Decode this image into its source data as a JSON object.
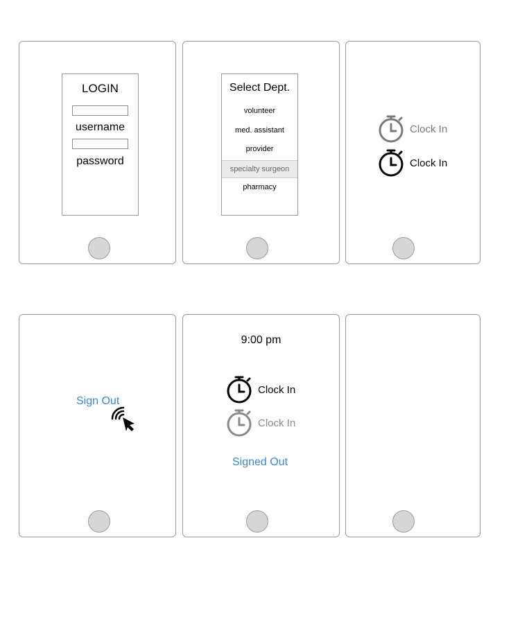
{
  "screens": {
    "login": {
      "title": "LOGIN",
      "username_label": "username",
      "password_label": "password"
    },
    "dept": {
      "title": "Select Dept.",
      "items": [
        {
          "label": "volunteer",
          "selected": false
        },
        {
          "label": "med. assistant",
          "selected": false
        },
        {
          "label": "provider",
          "selected": false
        },
        {
          "label": "specialty surgeon",
          "selected": true
        },
        {
          "label": "pharmacy",
          "selected": false
        }
      ]
    },
    "clock_in": {
      "options": [
        {
          "label": "Clock In",
          "state": "inactive"
        },
        {
          "label": "Clock In",
          "state": "active"
        }
      ]
    },
    "sign_out": {
      "link_label": "Sign Out"
    },
    "status": {
      "time": "9:00 pm",
      "options": [
        {
          "label": "Clock In",
          "state": "active"
        },
        {
          "label": "Clock In",
          "state": "inactive"
        }
      ],
      "signed_out_label": "Signed Out"
    }
  },
  "colors": {
    "link": "#3d86d0",
    "inactive": "#7a7a7a",
    "active": "#000000",
    "frame": "#9a9a9a",
    "home_button": "#d6d6d6"
  },
  "icons": {
    "clock": "stopwatch-icon",
    "cursor": "tap-cursor-icon"
  }
}
